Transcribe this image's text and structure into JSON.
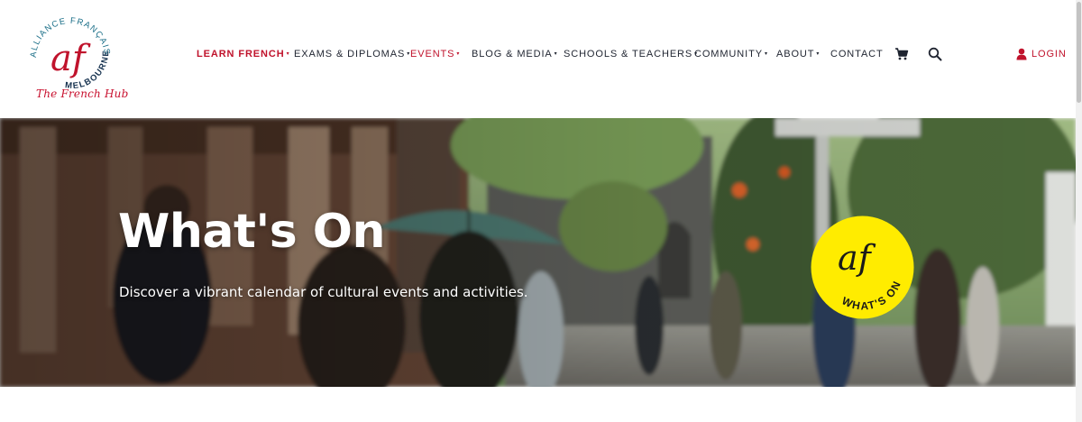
{
  "brand": {
    "logo_ring_text": "ALLIANCE FRANÇAISE",
    "logo_city": "MELBOURNE",
    "logo_mark": "af",
    "tagline": "The French Hub",
    "colors": {
      "red": "#c0132c",
      "navy": "#16324f",
      "teal": "#1b6f88",
      "yellow": "#ffec00"
    }
  },
  "nav": {
    "items": [
      {
        "label": "LEARN FRENCH",
        "caret": "▾"
      },
      {
        "label": "EXAMS & DIPLOMAS",
        "caret": "▾"
      },
      {
        "label": "EVENTS",
        "caret": "▾"
      },
      {
        "label": "BLOG & MEDIA",
        "caret": "▾"
      },
      {
        "label": "SCHOOLS & TEACHERS",
        "caret": "▾"
      },
      {
        "label": "COMMUNITY",
        "caret": "▾"
      },
      {
        "label": "ABOUT",
        "caret": "▾"
      },
      {
        "label": "CONTACT",
        "caret": ""
      }
    ],
    "cart_icon": "cart-icon",
    "search_icon": "search-icon",
    "login_label": "LOGIN",
    "login_icon": "user-icon"
  },
  "hero": {
    "title": "What's On",
    "subtitle": "Discover a vibrant calendar of cultural events and activities.",
    "badge_mark": "af",
    "badge_text": "WHAT'S ON"
  }
}
